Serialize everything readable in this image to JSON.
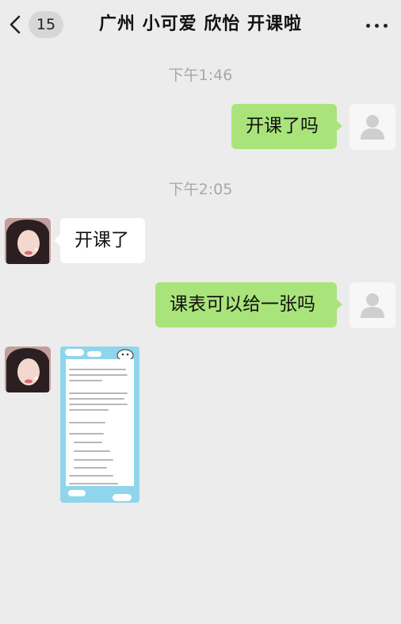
{
  "header": {
    "back_count": "15",
    "title": "广州 小可爱 欣怡  开课啦"
  },
  "messages": [
    {
      "type": "time",
      "text": "下午1:46"
    },
    {
      "type": "text",
      "sender": "me",
      "text": "开课了吗"
    },
    {
      "type": "time",
      "text": "下午2:05"
    },
    {
      "type": "text",
      "sender": "contact",
      "text": "开课了"
    },
    {
      "type": "text",
      "sender": "me",
      "text": "课表可以给一张吗"
    },
    {
      "type": "image",
      "sender": "contact"
    }
  ],
  "colors": {
    "background": "#ececec",
    "outgoing_bubble": "#a9e47a",
    "incoming_bubble": "#ffffff",
    "image_theme": "#8fd5ec"
  },
  "icons": {
    "back": "chevron-left-icon",
    "more": "ellipsis-icon",
    "default_avatar": "person-silhouette-icon"
  }
}
